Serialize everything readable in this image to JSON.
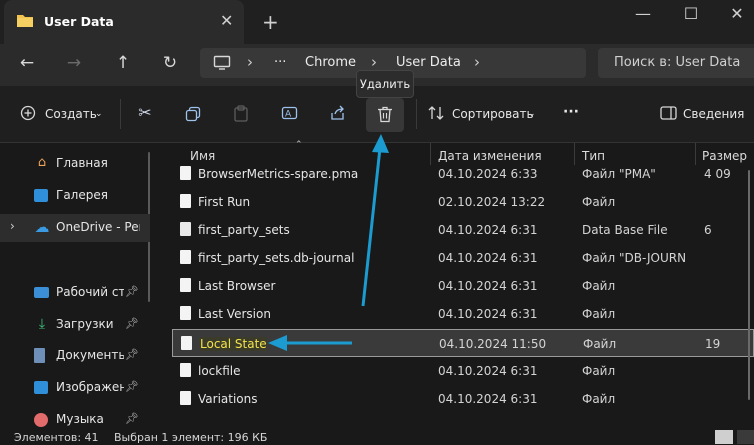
{
  "window": {
    "tab_title": "User Data",
    "tab_close": "✕",
    "new_tab": "+",
    "minimize": "—",
    "maximize": "☐",
    "close": "✕"
  },
  "address": {
    "back": "←",
    "forward": "→",
    "up": "↑",
    "refresh": "↻",
    "more": "···",
    "crumbs": [
      "Chrome",
      "User Data"
    ],
    "search_placeholder": "Поиск в: User Data"
  },
  "commandbar": {
    "create": "Создать",
    "sort": "Сортировать",
    "more": "···",
    "details": "Сведения",
    "delete_tooltip": "Удалить"
  },
  "navpane": {
    "items": [
      {
        "label": "Главная",
        "icon": "home-icon"
      },
      {
        "label": "Галерея",
        "icon": "gallery-icon"
      },
      {
        "label": "OneDrive - Perso",
        "icon": "cloud-icon"
      },
      {
        "label": "Рабочий сто",
        "icon": "desktop-icon"
      },
      {
        "label": "Загрузки",
        "icon": "download-icon"
      },
      {
        "label": "Документы",
        "icon": "document-icon"
      },
      {
        "label": "Изображени",
        "icon": "pictures-icon"
      },
      {
        "label": "Музыка",
        "icon": "music-icon"
      }
    ]
  },
  "columns": {
    "name": "Имя",
    "date": "Дата изменения",
    "type": "Тип",
    "size": "Размер"
  },
  "files": [
    {
      "name": "BrowserMetrics-spare.pma",
      "date": "04.10.2024 6:33",
      "type": "Файл \"PMA\"",
      "size": "4 09"
    },
    {
      "name": "First Run",
      "date": "02.10.2024 13:22",
      "type": "Файл",
      "size": ""
    },
    {
      "name": "first_party_sets",
      "date": "04.10.2024 6:31",
      "type": "Data Base File",
      "size": "6"
    },
    {
      "name": "first_party_sets.db-journal",
      "date": "04.10.2024 6:31",
      "type": "Файл \"DB-JOURN",
      "size": ""
    },
    {
      "name": "Last Browser",
      "date": "04.10.2024 6:31",
      "type": "Файл",
      "size": ""
    },
    {
      "name": "Last Version",
      "date": "04.10.2024 6:31",
      "type": "Файл",
      "size": ""
    },
    {
      "name": "Local State",
      "date": "04.10.2024 11:50",
      "type": "Файл",
      "size": "19"
    },
    {
      "name": "lockfile",
      "date": "04.10.2024 6:31",
      "type": "Файл",
      "size": ""
    },
    {
      "name": "Variations",
      "date": "04.10.2024 6:31",
      "type": "Файл",
      "size": ""
    }
  ],
  "status": {
    "count": "Элементов: 41",
    "selection": "Выбран 1 элемент: 196 КБ"
  },
  "colors": {
    "accent_arrow": "#1c9bd0",
    "highlight_text": "#f2e34c",
    "folder": "#f2c14e"
  }
}
